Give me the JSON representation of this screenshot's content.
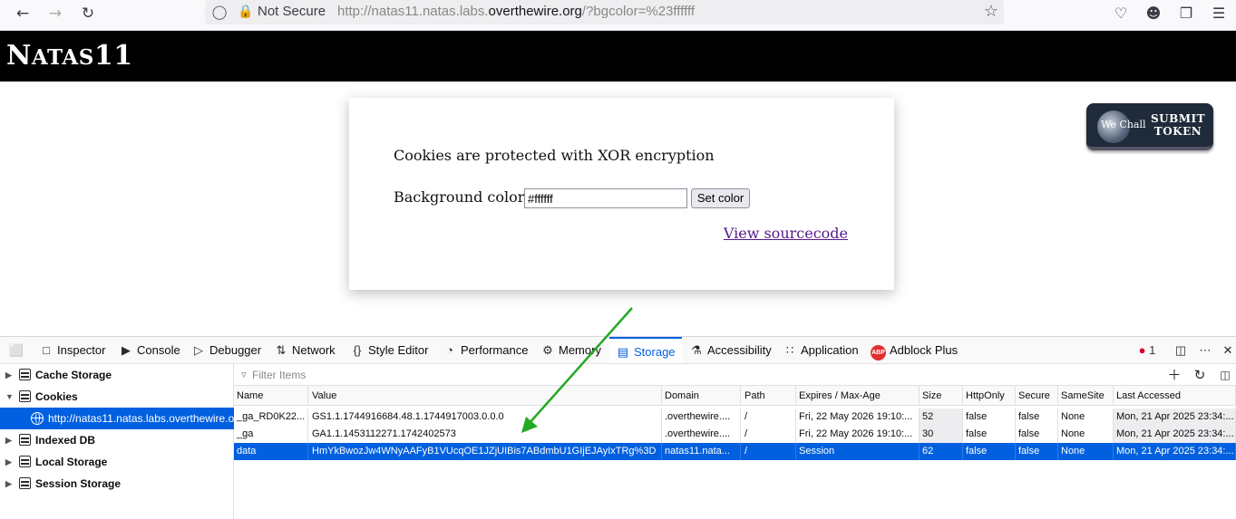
{
  "browser": {
    "not_secure": "Not Secure",
    "url_prefix": "http://natas11.natas.labs.",
    "url_host": "overthewire.org",
    "url_suffix": "/?bgcolor=%23ffffff"
  },
  "page": {
    "banner_title_big": "N",
    "banner_title_small": "ATAS",
    "banner_title_num": "11",
    "heading": "Cookies are protected with XOR encryption",
    "bg_label": "Background color:",
    "bg_value": "#ffffff",
    "set_button": "Set color",
    "view_source": "View sourcecode",
    "wechall": {
      "logo_text": "We Chall",
      "line1": "SUBMIT",
      "line2": "TOKEN"
    }
  },
  "devtools": {
    "tabs": [
      {
        "label": "Inspector",
        "icon": "inspector-icon"
      },
      {
        "label": "Console",
        "icon": "console-icon"
      },
      {
        "label": "Debugger",
        "icon": "debugger-icon"
      },
      {
        "label": "Network",
        "icon": "network-icon"
      },
      {
        "label": "Style Editor",
        "icon": "style-editor-icon"
      },
      {
        "label": "Performance",
        "icon": "performance-icon"
      },
      {
        "label": "Memory",
        "icon": "memory-icon"
      },
      {
        "label": "Storage",
        "icon": "storage-icon"
      },
      {
        "label": "Accessibility",
        "icon": "accessibility-icon"
      },
      {
        "label": "Application",
        "icon": "application-icon"
      },
      {
        "label": "Adblock Plus",
        "icon": "adblock-icon"
      }
    ],
    "error_count": "1",
    "sidebar": {
      "cache_storage": "Cache Storage",
      "cookies": "Cookies",
      "cookie_host": "http://natas11.natas.labs.overthewire.org",
      "indexed_db": "Indexed DB",
      "local_storage": "Local Storage",
      "session_storage": "Session Storage"
    },
    "filter_placeholder": "Filter Items",
    "columns": [
      "Name",
      "Value",
      "Domain",
      "Path",
      "Expires / Max-Age",
      "Size",
      "HttpOnly",
      "Secure",
      "SameSite",
      "Last Accessed"
    ],
    "rows": [
      [
        "_ga_RD0K22...",
        "GS1.1.1744916684.48.1.1744917003.0.0.0",
        ".overthewire....",
        "/",
        "Fri, 22 May 2026 19:10:...",
        "52",
        "false",
        "false",
        "None",
        "Mon, 21 Apr 2025 23:34:..."
      ],
      [
        "_ga",
        "GA1.1.1453112271.1742402573",
        ".overthewire....",
        "/",
        "Fri, 22 May 2026 19:10:...",
        "30",
        "false",
        "false",
        "None",
        "Mon, 21 Apr 2025 23:34:..."
      ],
      [
        "data",
        "HmYkBwozJw4WNyAAFyB1VUcqOE1JZjUIBis7ABdmbU1GIjEJAyIxTRg%3D",
        "natas11.nata...",
        "/",
        "Session",
        "62",
        "false",
        "false",
        "None",
        "Mon, 21 Apr 2025 23:34:..."
      ]
    ],
    "selected_row": 2
  },
  "colors": {
    "accent": "#0060df",
    "arrow": "#22aa22",
    "visited_link": "#551a8b"
  }
}
